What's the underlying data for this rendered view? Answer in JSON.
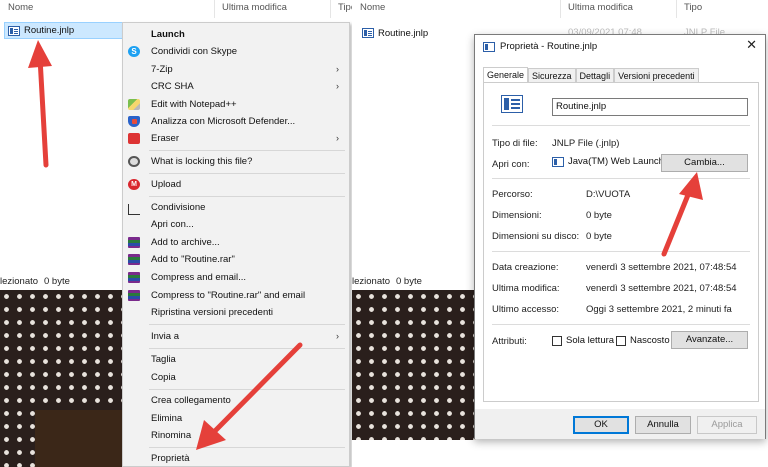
{
  "left": {
    "headers": {
      "name": "Nome",
      "modified": "Ultima modifica",
      "type": "Tipo"
    },
    "file": {
      "name": "Routine.jnlp"
    },
    "status": {
      "count_fragment": "lezionato",
      "size": "0 byte"
    }
  },
  "menu": {
    "items": [
      {
        "label": "Launch",
        "bold": true
      },
      {
        "label": "Condividi con Skype",
        "icon": "skype-icon"
      },
      {
        "label": "7-Zip",
        "submenu": true
      },
      {
        "label": "CRC SHA",
        "submenu": true
      },
      {
        "label": "Edit with Notepad++",
        "icon": "notepadpp-icon"
      },
      {
        "label": "Analizza con Microsoft Defender...",
        "icon": "defender-shield-icon"
      },
      {
        "label": "Eraser",
        "icon": "eraser-icon",
        "submenu": true
      },
      {
        "label": "What is locking this file?",
        "icon": "gear-icon"
      },
      {
        "label": "Upload",
        "icon": "mega-icon"
      },
      {
        "label": "Condivisione",
        "icon": "share-icon"
      },
      {
        "label": "Apri con..."
      },
      {
        "label": "Add to archive...",
        "icon": "winrar-icon"
      },
      {
        "label": "Add to \"Routine.rar\"",
        "icon": "winrar-icon"
      },
      {
        "label": "Compress and email...",
        "icon": "winrar-icon"
      },
      {
        "label": "Compress to \"Routine.rar\" and email",
        "icon": "winrar-icon"
      },
      {
        "label": "Ripristina versioni precedenti"
      },
      {
        "label": "Invia a",
        "submenu": true
      },
      {
        "label": "Taglia"
      },
      {
        "label": "Copia"
      },
      {
        "label": "Crea collegamento"
      },
      {
        "label": "Elimina"
      },
      {
        "label": "Rinomina"
      },
      {
        "label": "Proprietà"
      }
    ]
  },
  "right": {
    "headers": {
      "name": "Nome",
      "modified": "Ultima modifica",
      "type": "Tipo"
    },
    "file": {
      "name": "Routine.jnlp",
      "modified": "03/09/2021 07:48",
      "type": "JNLP File"
    },
    "status": {
      "count_fragment": "lezionato",
      "size": "0 byte"
    }
  },
  "dialog": {
    "title": "Proprietà - Routine.jnlp",
    "tabs": [
      "Generale",
      "Sicurezza",
      "Dettagli",
      "Versioni precedenti"
    ],
    "active_tab": "Generale",
    "file_name": "Routine.jnlp",
    "type_label": "Tipo di file:",
    "type_value": "JNLP File (.jnlp)",
    "open_with_label": "Apri con:",
    "open_with_value": "Java(TM) Web Launch",
    "change_button": "Cambia...",
    "path_label": "Percorso:",
    "path_value": "D:\\VUOTA",
    "size_label": "Dimensioni:",
    "size_value": "0 byte",
    "disk_size_label": "Dimensioni su disco:",
    "disk_size_value": "0 byte",
    "created_label": "Data creazione:",
    "created_value": "venerdì 3 settembre 2021, 07:48:54",
    "modified_label": "Ultima modifica:",
    "modified_value": "venerdì 3 settembre 2021, 07:48:54",
    "accessed_label": "Ultimo accesso:",
    "accessed_value": "Oggi 3 settembre 2021, 2 minuti fa",
    "attributes_label": "Attributi:",
    "readonly_label": "Sola lettura",
    "hidden_label": "Nascosto",
    "advanced_button": "Avanzate...",
    "ok_button": "OK",
    "cancel_button": "Annulla",
    "apply_button": "Applica"
  },
  "colors": {
    "selection": "#cce8ff",
    "arrow": "#e5403a",
    "accent": "#0078d7"
  }
}
